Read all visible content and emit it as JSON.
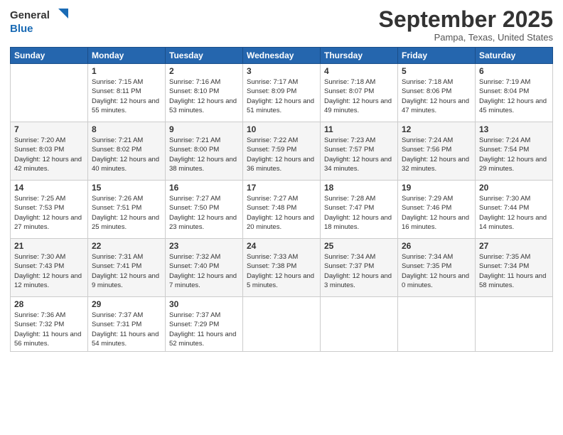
{
  "header": {
    "logo_line1": "General",
    "logo_line2": "Blue",
    "month": "September 2025",
    "location": "Pampa, Texas, United States"
  },
  "weekdays": [
    "Sunday",
    "Monday",
    "Tuesday",
    "Wednesday",
    "Thursday",
    "Friday",
    "Saturday"
  ],
  "weeks": [
    [
      {
        "day": "",
        "sunrise": "",
        "sunset": "",
        "daylight": ""
      },
      {
        "day": "1",
        "sunrise": "Sunrise: 7:15 AM",
        "sunset": "Sunset: 8:11 PM",
        "daylight": "Daylight: 12 hours and 55 minutes."
      },
      {
        "day": "2",
        "sunrise": "Sunrise: 7:16 AM",
        "sunset": "Sunset: 8:10 PM",
        "daylight": "Daylight: 12 hours and 53 minutes."
      },
      {
        "day": "3",
        "sunrise": "Sunrise: 7:17 AM",
        "sunset": "Sunset: 8:09 PM",
        "daylight": "Daylight: 12 hours and 51 minutes."
      },
      {
        "day": "4",
        "sunrise": "Sunrise: 7:18 AM",
        "sunset": "Sunset: 8:07 PM",
        "daylight": "Daylight: 12 hours and 49 minutes."
      },
      {
        "day": "5",
        "sunrise": "Sunrise: 7:18 AM",
        "sunset": "Sunset: 8:06 PM",
        "daylight": "Daylight: 12 hours and 47 minutes."
      },
      {
        "day": "6",
        "sunrise": "Sunrise: 7:19 AM",
        "sunset": "Sunset: 8:04 PM",
        "daylight": "Daylight: 12 hours and 45 minutes."
      }
    ],
    [
      {
        "day": "7",
        "sunrise": "Sunrise: 7:20 AM",
        "sunset": "Sunset: 8:03 PM",
        "daylight": "Daylight: 12 hours and 42 minutes."
      },
      {
        "day": "8",
        "sunrise": "Sunrise: 7:21 AM",
        "sunset": "Sunset: 8:02 PM",
        "daylight": "Daylight: 12 hours and 40 minutes."
      },
      {
        "day": "9",
        "sunrise": "Sunrise: 7:21 AM",
        "sunset": "Sunset: 8:00 PM",
        "daylight": "Daylight: 12 hours and 38 minutes."
      },
      {
        "day": "10",
        "sunrise": "Sunrise: 7:22 AM",
        "sunset": "Sunset: 7:59 PM",
        "daylight": "Daylight: 12 hours and 36 minutes."
      },
      {
        "day": "11",
        "sunrise": "Sunrise: 7:23 AM",
        "sunset": "Sunset: 7:57 PM",
        "daylight": "Daylight: 12 hours and 34 minutes."
      },
      {
        "day": "12",
        "sunrise": "Sunrise: 7:24 AM",
        "sunset": "Sunset: 7:56 PM",
        "daylight": "Daylight: 12 hours and 32 minutes."
      },
      {
        "day": "13",
        "sunrise": "Sunrise: 7:24 AM",
        "sunset": "Sunset: 7:54 PM",
        "daylight": "Daylight: 12 hours and 29 minutes."
      }
    ],
    [
      {
        "day": "14",
        "sunrise": "Sunrise: 7:25 AM",
        "sunset": "Sunset: 7:53 PM",
        "daylight": "Daylight: 12 hours and 27 minutes."
      },
      {
        "day": "15",
        "sunrise": "Sunrise: 7:26 AM",
        "sunset": "Sunset: 7:51 PM",
        "daylight": "Daylight: 12 hours and 25 minutes."
      },
      {
        "day": "16",
        "sunrise": "Sunrise: 7:27 AM",
        "sunset": "Sunset: 7:50 PM",
        "daylight": "Daylight: 12 hours and 23 minutes."
      },
      {
        "day": "17",
        "sunrise": "Sunrise: 7:27 AM",
        "sunset": "Sunset: 7:48 PM",
        "daylight": "Daylight: 12 hours and 20 minutes."
      },
      {
        "day": "18",
        "sunrise": "Sunrise: 7:28 AM",
        "sunset": "Sunset: 7:47 PM",
        "daylight": "Daylight: 12 hours and 18 minutes."
      },
      {
        "day": "19",
        "sunrise": "Sunrise: 7:29 AM",
        "sunset": "Sunset: 7:46 PM",
        "daylight": "Daylight: 12 hours and 16 minutes."
      },
      {
        "day": "20",
        "sunrise": "Sunrise: 7:30 AM",
        "sunset": "Sunset: 7:44 PM",
        "daylight": "Daylight: 12 hours and 14 minutes."
      }
    ],
    [
      {
        "day": "21",
        "sunrise": "Sunrise: 7:30 AM",
        "sunset": "Sunset: 7:43 PM",
        "daylight": "Daylight: 12 hours and 12 minutes."
      },
      {
        "day": "22",
        "sunrise": "Sunrise: 7:31 AM",
        "sunset": "Sunset: 7:41 PM",
        "daylight": "Daylight: 12 hours and 9 minutes."
      },
      {
        "day": "23",
        "sunrise": "Sunrise: 7:32 AM",
        "sunset": "Sunset: 7:40 PM",
        "daylight": "Daylight: 12 hours and 7 minutes."
      },
      {
        "day": "24",
        "sunrise": "Sunrise: 7:33 AM",
        "sunset": "Sunset: 7:38 PM",
        "daylight": "Daylight: 12 hours and 5 minutes."
      },
      {
        "day": "25",
        "sunrise": "Sunrise: 7:34 AM",
        "sunset": "Sunset: 7:37 PM",
        "daylight": "Daylight: 12 hours and 3 minutes."
      },
      {
        "day": "26",
        "sunrise": "Sunrise: 7:34 AM",
        "sunset": "Sunset: 7:35 PM",
        "daylight": "Daylight: 12 hours and 0 minutes."
      },
      {
        "day": "27",
        "sunrise": "Sunrise: 7:35 AM",
        "sunset": "Sunset: 7:34 PM",
        "daylight": "Daylight: 11 hours and 58 minutes."
      }
    ],
    [
      {
        "day": "28",
        "sunrise": "Sunrise: 7:36 AM",
        "sunset": "Sunset: 7:32 PM",
        "daylight": "Daylight: 11 hours and 56 minutes."
      },
      {
        "day": "29",
        "sunrise": "Sunrise: 7:37 AM",
        "sunset": "Sunset: 7:31 PM",
        "daylight": "Daylight: 11 hours and 54 minutes."
      },
      {
        "day": "30",
        "sunrise": "Sunrise: 7:37 AM",
        "sunset": "Sunset: 7:29 PM",
        "daylight": "Daylight: 11 hours and 52 minutes."
      },
      {
        "day": "",
        "sunrise": "",
        "sunset": "",
        "daylight": ""
      },
      {
        "day": "",
        "sunrise": "",
        "sunset": "",
        "daylight": ""
      },
      {
        "day": "",
        "sunrise": "",
        "sunset": "",
        "daylight": ""
      },
      {
        "day": "",
        "sunrise": "",
        "sunset": "",
        "daylight": ""
      }
    ]
  ]
}
